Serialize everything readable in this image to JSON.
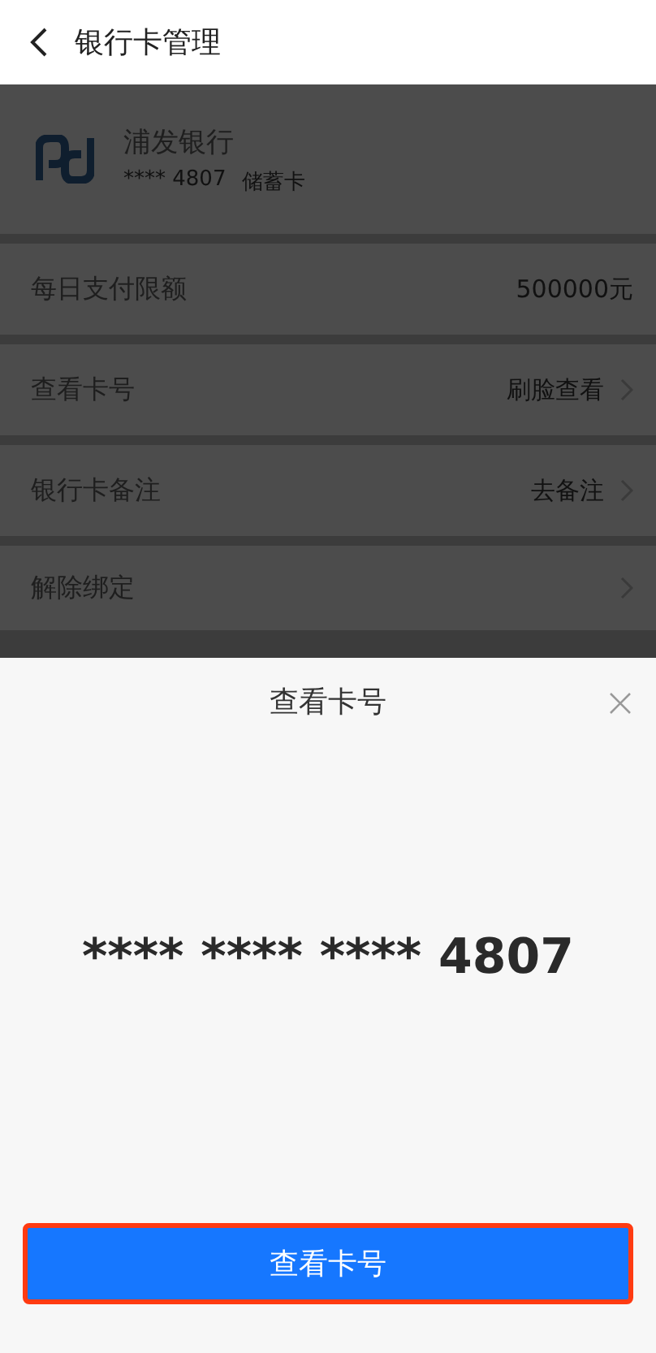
{
  "header": {
    "title": "银行卡管理"
  },
  "card": {
    "bank": "浦发银行",
    "number": "**** 4807",
    "type": "储蓄卡"
  },
  "rows": [
    {
      "label": "每日支付限额",
      "value": "500000元",
      "chevron": false
    },
    {
      "label": "查看卡号",
      "value": "刷脸查看",
      "chevron": true
    },
    {
      "label": "银行卡备注",
      "value": "去备注",
      "chevron": true
    },
    {
      "label": "解除绑定",
      "chevron": true
    }
  ],
  "sheet": {
    "title": "查看卡号",
    "card_number": "**** **** **** 4807",
    "button": "查看卡号"
  }
}
